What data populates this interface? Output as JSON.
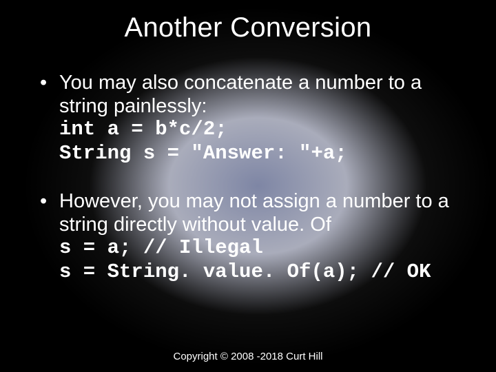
{
  "title": "Another Conversion",
  "bullets": [
    {
      "text": "You may also concatenate a number to a string painlessly:",
      "code": "int a = b*c/2;\nString s = \"Answer: \"+a;"
    },
    {
      "text": "However, you may not assign a number to a string directly without value. Of",
      "code": "s = a; // Illegal\ns = String. value. Of(a); // OK"
    }
  ],
  "footer": "Copyright © 2008 -2018 Curt Hill"
}
